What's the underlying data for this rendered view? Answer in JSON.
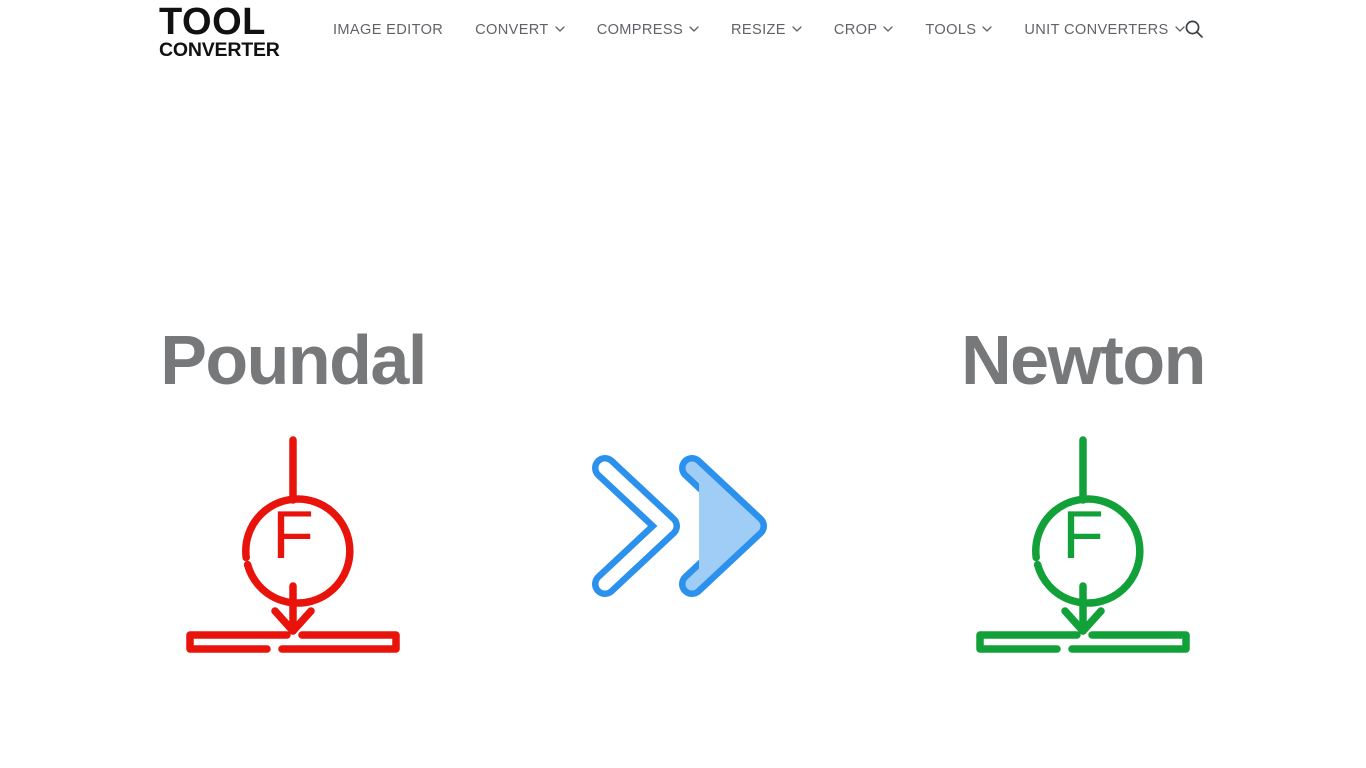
{
  "header": {
    "logo": {
      "line1": "TOOL",
      "line2": "CONVERTER"
    },
    "nav": [
      {
        "label": "IMAGE EDITOR",
        "has_dropdown": false
      },
      {
        "label": "CONVERT",
        "has_dropdown": true
      },
      {
        "label": "COMPRESS",
        "has_dropdown": true
      },
      {
        "label": "RESIZE",
        "has_dropdown": true
      },
      {
        "label": "CROP",
        "has_dropdown": true
      },
      {
        "label": "TOOLS",
        "has_dropdown": true
      },
      {
        "label": "UNIT CONVERTERS",
        "has_dropdown": true
      }
    ],
    "search_icon": "search-icon"
  },
  "main": {
    "source": {
      "title": "Poundal",
      "icon": "force-icon",
      "icon_letter": "F",
      "color": "#e8140c"
    },
    "target": {
      "title": "Newton",
      "icon": "force-icon",
      "icon_letter": "F",
      "color": "#12a038"
    },
    "conversion_arrow": {
      "icon": "double-chevron-right-icon",
      "stroke_color": "#2b91ec",
      "fill_color": "#9fcdf5"
    }
  },
  "colors": {
    "logo": "#111111",
    "nav_text": "#5f6368",
    "heading": "#77787a",
    "background": "#ffffff"
  }
}
